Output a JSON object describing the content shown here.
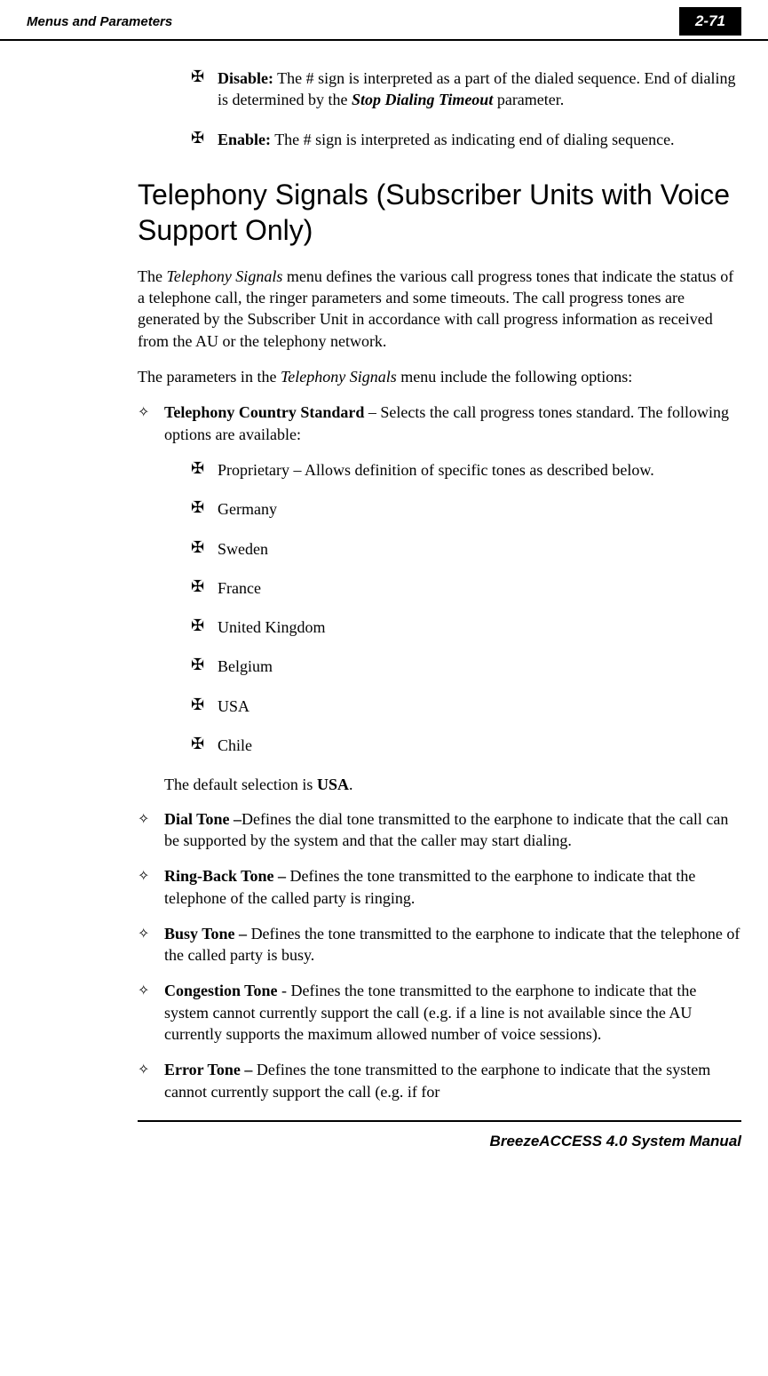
{
  "header": {
    "section": "Menus and Parameters",
    "page": "2-71"
  },
  "intro_sub": [
    {
      "label": "Disable:",
      "text_before": " The # sign is interpreted as a part of the dialed sequence. End of dialing is determined by the ",
      "ref": "Stop Dialing Timeout",
      "text_after": " parameter."
    },
    {
      "label": "Enable:",
      "text_before": " The # sign is interpreted as indicating end of dialing sequence.",
      "ref": "",
      "text_after": ""
    }
  ],
  "heading": "Telephony Signals (Subscriber Units with Voice Support Only)",
  "para1_a": "The ",
  "para1_i": "Telephony Signals",
  "para1_b": " menu defines the various call progress tones that indicate the status of a telephone call, the ringer parameters and some timeouts. The call progress tones are generated by the Subscriber Unit in accordance with call progress information as received from the AU or the telephony network.",
  "para2_a": "The parameters in the ",
  "para2_i": "Telephony Signals",
  "para2_b": " menu include the following options:",
  "items": [
    {
      "label": "Telephony Country Standard",
      "sep": " – ",
      "text": "Selects the call progress tones standard. The following options are available:"
    }
  ],
  "standards_first": "Proprietary – Allows definition of specific tones as described below.",
  "standards": [
    "Germany",
    "Sweden",
    "France",
    "United Kingdom",
    "Belgium",
    "USA",
    "Chile"
  ],
  "default_a": "The default selection is ",
  "default_b": "USA",
  "default_c": ".",
  "tones": [
    {
      "label": "Dial Tone –",
      "text": "Defines the dial tone transmitted to the earphone to indicate that the call can be supported by the system and that the caller may start dialing."
    },
    {
      "label": "Ring-Back Tone – ",
      "text": "Defines the tone transmitted to the earphone to indicate that the telephone of the called party is ringing."
    },
    {
      "label": "Busy Tone – ",
      "text": "Defines the tone transmitted to the earphone to indicate that the telephone of the called party is busy."
    },
    {
      "label": "Congestion Tone ",
      "text": "- Defines the tone transmitted to the earphone to indicate that the system cannot currently support the call (e.g. if a line is not available since the AU currently supports the maximum allowed number of voice sessions)."
    },
    {
      "label": "Error Tone – ",
      "text": "Defines the tone transmitted to the earphone to indicate that the system cannot currently support the call (e.g. if for"
    }
  ],
  "footer": "BreezeACCESS 4.0 System Manual"
}
